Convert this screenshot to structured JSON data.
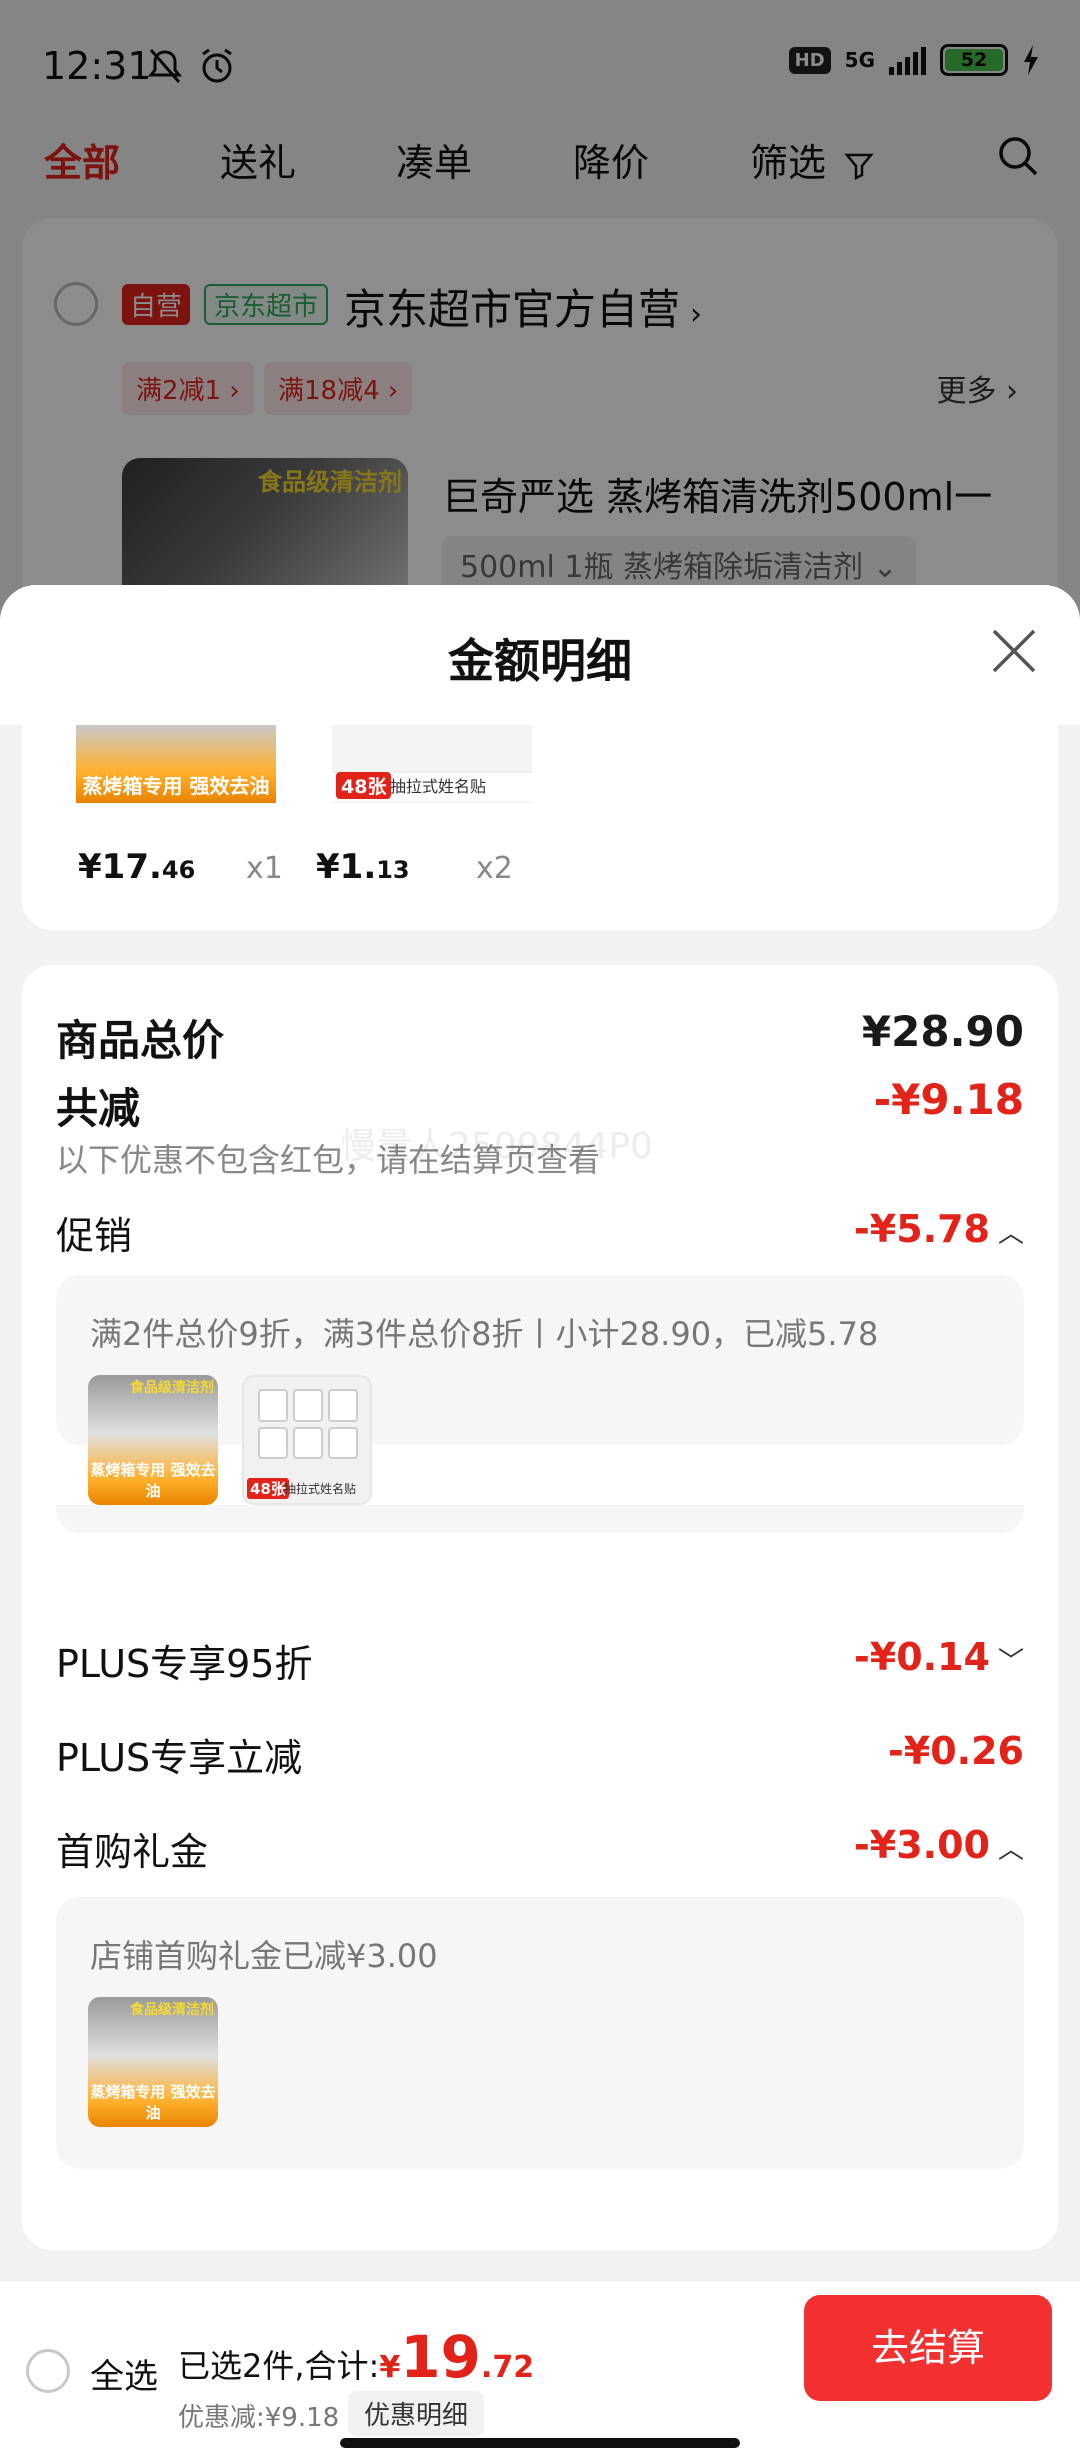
{
  "status_bar": {
    "time": "12:31",
    "hd": "HD",
    "network": "5G",
    "battery": "52"
  },
  "tabs": [
    {
      "label": "全部",
      "active": true
    },
    {
      "label": "送礼"
    },
    {
      "label": "凑单"
    },
    {
      "label": "降价"
    },
    {
      "label": "筛选"
    }
  ],
  "store": {
    "self_tag": "自营",
    "market_tag": "京东超市",
    "name": "京东超市官方自营",
    "promos": [
      "满2减1",
      "满18减4"
    ],
    "more": "更多"
  },
  "product": {
    "thumb_label": "食品级清洁剂",
    "title": "巨奇严选 蒸烤箱清洗剂500ml一",
    "spec": "500ml 1瓶 蒸烤箱除垢清洁剂"
  },
  "sheet": {
    "title": "金额明细",
    "items": [
      {
        "caption": "蒸烤箱专用 强效去油",
        "price_int": "¥17.",
        "price_dec": "46",
        "qty": "x1"
      },
      {
        "badge": "48张",
        "caption": "抽拉式姓名贴",
        "price_int": "¥1.",
        "price_dec": "13",
        "qty": "x2"
      }
    ],
    "total_label": "商品总价",
    "total_value": "¥28.90",
    "reduce_label": "共减",
    "reduce_value": "-¥9.18",
    "reduce_note": "以下优惠不包含红包，请在结算页查看",
    "watermark": "慢量人2509844P0",
    "promo_label": "促销",
    "promo_value": "-¥5.78",
    "promo_text": "满2件总价9折，满3件总价8折丨小计28.90，已减5.78",
    "plus95_label": "PLUS专享95折",
    "plus95_value": "-¥0.14",
    "plus_reduce_label": "PLUS专享立减",
    "plus_reduce_value": "-¥0.26",
    "first_label": "首购礼金",
    "first_value": "-¥3.00",
    "first_text": "店铺首购礼金已减¥3.00",
    "mini_a_top": "食品级清洁剂",
    "mini_a_cap": "蒸烤箱专用 强效去油",
    "mini_b_badge": "48张",
    "mini_b_cap": "抽拉式姓名贴"
  },
  "bottom": {
    "select_all": "全选",
    "selected_prefix": "已选2件,合计:",
    "currency": "¥",
    "total_int": "19",
    "total_dec": ".72",
    "discount": "优惠减:¥9.18",
    "detail_chip": "优惠明细",
    "checkout": "去结算"
  },
  "colors": {
    "accent": "#e2231a",
    "checkout": "#f23030",
    "self_tag": "#e2231a",
    "market_tag": "#2eaa5c"
  }
}
